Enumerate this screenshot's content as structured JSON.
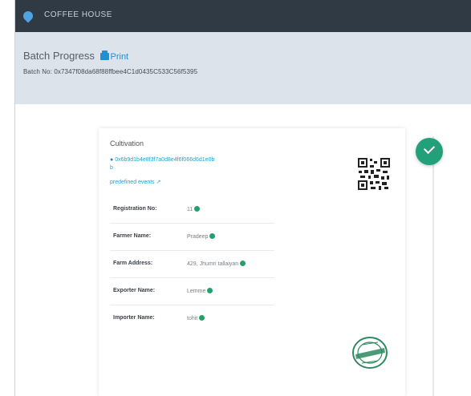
{
  "app": {
    "name": "COFFEE HOUSE"
  },
  "page": {
    "title": "Batch Progress",
    "print_label": "Print",
    "batch_no": "Batch No: 0x7347f08da68f88ffbee4C1d0435C533C56f5395"
  },
  "stage": {
    "title": "Cultivation",
    "tx_hash": "0x6b9d1b4e8f3f7a0d8e4f6f066d6d1e0b",
    "tx_suffix": "b",
    "tx_meta": "predefined events ↗",
    "fields": [
      {
        "label": "Registration No:",
        "value": "11"
      },
      {
        "label": "Farmer Name:",
        "value": "Pradeep"
      },
      {
        "label": "Farm Address:",
        "value": "429, Jhumri tallaiyan"
      },
      {
        "label": "Exporter Name:",
        "value": "Lemme"
      },
      {
        "label": "Importer Name:",
        "value": "tohit"
      }
    ]
  },
  "colors": {
    "topbar": "#2f3a45",
    "accent": "#1f8fd6",
    "verified": "#24a06b",
    "status_circle": "#22a07a"
  },
  "icons": {
    "logo": "droplet-icon",
    "print": "printer-icon",
    "verified": "verified-dot-icon",
    "qr": "qr-code-icon",
    "stamp": "certified-stamp-icon",
    "status": "check-icon"
  }
}
